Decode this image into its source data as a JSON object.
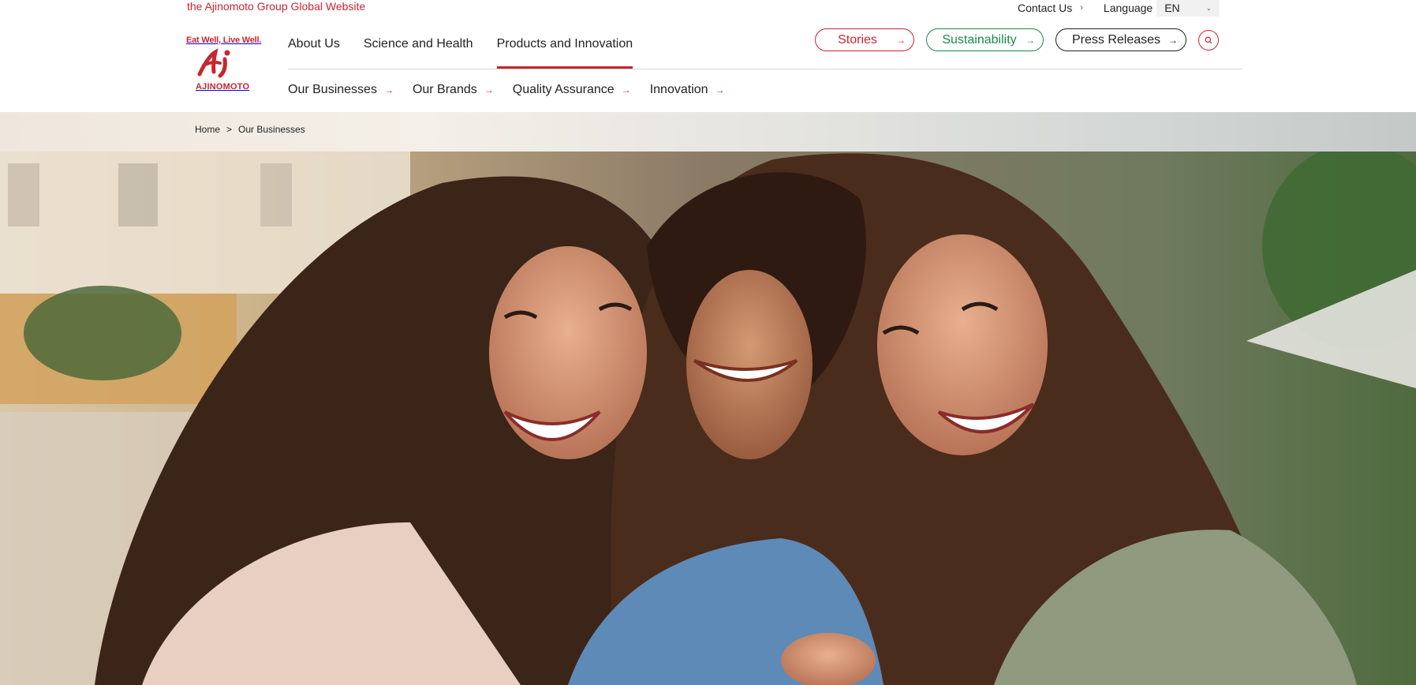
{
  "top_link": "the Ajinomoto Group Global Website",
  "utility": {
    "contact": "Contact Us",
    "language_label": "Language",
    "language_value": "EN"
  },
  "logo": {
    "tagline": "Eat Well, Live Well.",
    "wordmark": "AJINOMOTO"
  },
  "nav_main": [
    "About Us",
    "Science and Health",
    "Products and Innovation"
  ],
  "nav_active": "Products and Innovation",
  "pills": {
    "stories": "Stories",
    "sustainability": "Sustainability",
    "press": "Press Releases"
  },
  "nav_sub": [
    "Our Businesses",
    "Our Brands",
    "Quality Assurance",
    "Innovation"
  ],
  "breadcrumb": {
    "home": "Home",
    "separator": ">",
    "current": "Our Businesses"
  },
  "colors": {
    "brand_red": "#c8262f",
    "sustainability_green": "#1a8a4a"
  },
  "icons": {
    "search": "search-icon",
    "arrow": "arrow-right-icon",
    "chevron": "chevron-down-icon"
  }
}
